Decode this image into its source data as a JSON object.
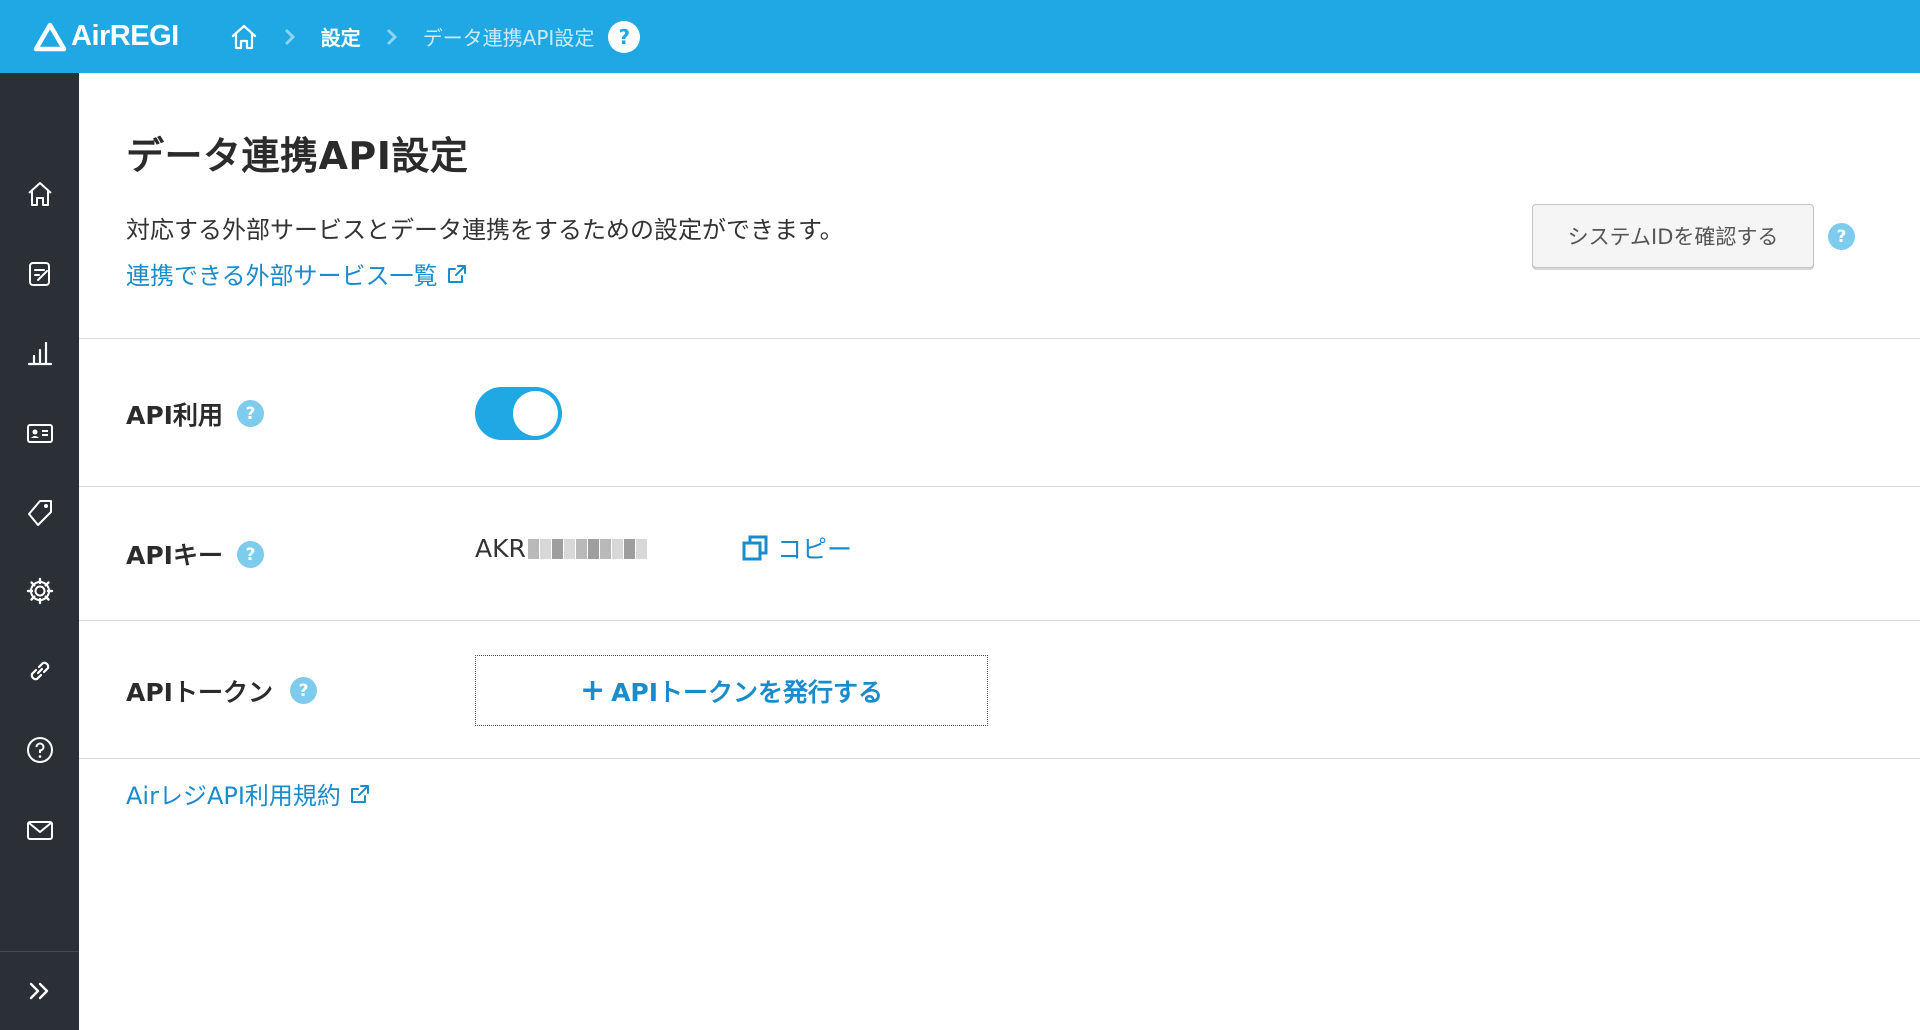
{
  "header": {
    "logo_text": "AirREGI",
    "breadcrumb": {
      "home_icon": "home-icon",
      "items": [
        {
          "label": "設定"
        },
        {
          "label": "データ連携API設定"
        }
      ],
      "help_label": "?"
    }
  },
  "sidebar": {
    "items": [
      {
        "icon": "home-icon"
      },
      {
        "icon": "edit-note-icon"
      },
      {
        "icon": "bar-chart-icon"
      },
      {
        "icon": "contact-card-icon"
      },
      {
        "icon": "tag-icon"
      },
      {
        "icon": "gear-icon"
      },
      {
        "icon": "link-icon"
      },
      {
        "icon": "help-circle-icon"
      },
      {
        "icon": "mail-icon"
      }
    ],
    "expand_icon": "double-chevron-right-icon"
  },
  "main": {
    "title": "データ連携API設定",
    "description": "対応する外部サービスとデータ連携をするための設定ができます。",
    "services_link": "連携できる外部サービス一覧",
    "system_id_button": "システムIDを確認する",
    "help_label": "?",
    "rows": {
      "api_usage": {
        "label": "API利用",
        "enabled": true
      },
      "api_key": {
        "label": "APIキー",
        "value_prefix": "AKR",
        "copy_label": "コピー"
      },
      "api_token": {
        "label": "APIトークン",
        "plus": "+",
        "button_label": "APIトークンを発行する"
      }
    },
    "terms_link": "AirレジAPI利用規約"
  },
  "colors": {
    "brand": "#1fa8e3",
    "sidebar": "#2a3035",
    "link": "#1a8ccc",
    "help_dot": "#7dcbed"
  }
}
